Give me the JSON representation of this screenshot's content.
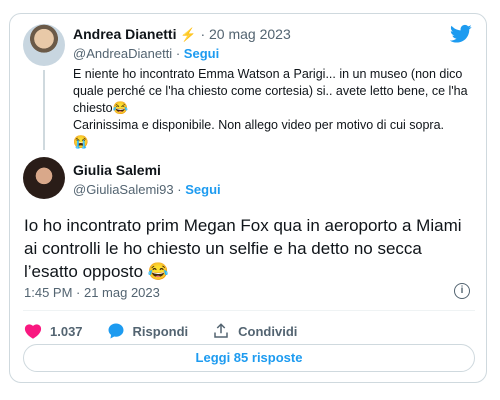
{
  "quoted_tweet": {
    "author_name": "Andrea Dianetti",
    "verified_emoji": "⚡",
    "date": "20 mag 2023",
    "handle": "@AndreaDianetti",
    "follow_label": "Segui",
    "text_lines": [
      "E niente ho incontrato Emma Watson a Parigi... in un museo (non dico quale perché ce l'ha chiesto come cortesia) si.. avete letto bene, ce l'ha chiesto😂",
      "Carinissima e disponibile. Non allego video per motivo di cui sopra.",
      "😭"
    ]
  },
  "main_tweet": {
    "author_name": "Giulia Salemi",
    "handle": "@GiuliaSalemi93",
    "follow_label": "Segui",
    "text": "Io ho incontrato prim Megan Fox qua in aeroporto a Miami ai controlli le ho chiesto un selfie e ha detto no secca l’esatto opposto 😂",
    "timestamp": "1:45 PM · 21 mag 2023",
    "likes": "1.037",
    "reply_label": "Rispondi",
    "share_label": "Condividi",
    "read_replies_label": "Leggi 85 risposte"
  },
  "colors": {
    "accent": "#1d9bf0",
    "like": "#f91880",
    "muted": "#536471"
  },
  "icons": {
    "logo": "twitter-bird-icon",
    "info": "info-icon",
    "like": "heart-icon",
    "reply": "speech-bubble-icon",
    "share": "share-upload-icon"
  }
}
